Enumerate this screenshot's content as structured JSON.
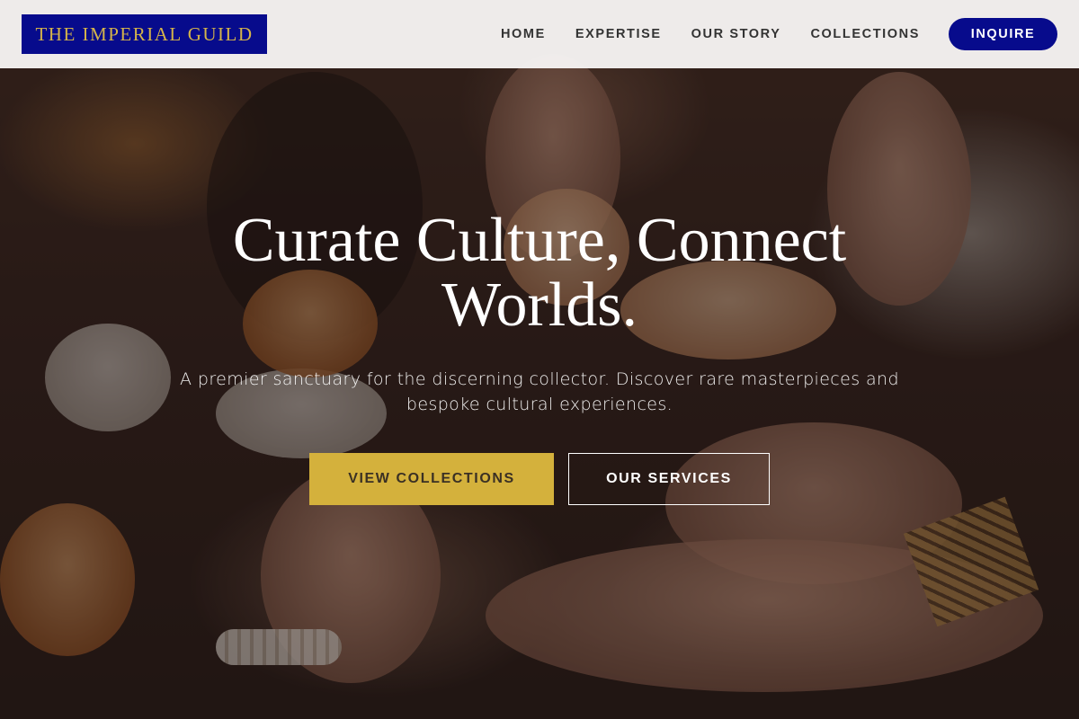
{
  "brand": {
    "name": "THE IMPERIAL GUILD",
    "colors": {
      "primary": "#070b8c",
      "gold": "#d4b13c"
    }
  },
  "nav": {
    "items": [
      {
        "label": "HOME"
      },
      {
        "label": "EXPERTISE"
      },
      {
        "label": "OUR STORY"
      },
      {
        "label": "COLLECTIONS"
      }
    ],
    "cta_label": "INQUIRE"
  },
  "hero": {
    "headline": "Curate Culture, Connect Worlds.",
    "subtitle": "A premier sanctuary for the discerning collector. Discover rare masterpieces and bespoke cultural experiences.",
    "primary_button": "VIEW COLLECTIONS",
    "secondary_button": "OUR SERVICES"
  }
}
